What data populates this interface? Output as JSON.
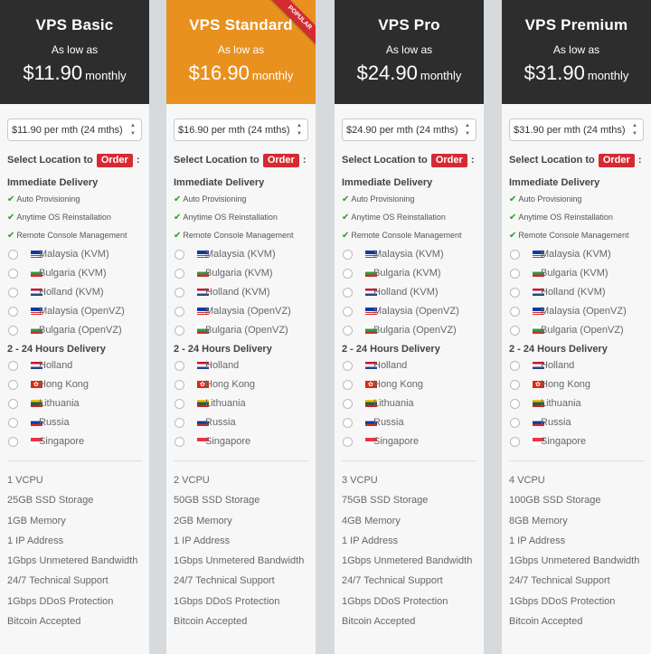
{
  "plans": [
    {
      "name": "VPS Basic",
      "as_low": "As low as",
      "price": "$11.90",
      "period": "monthly",
      "select_value": "$11.90 per mth (24 mths)",
      "specs": [
        "1 VCPU",
        "25GB SSD Storage",
        "1GB Memory",
        "1 IP Address",
        "1Gbps Unmetered Bandwidth",
        "24/7 Technical Support",
        "1Gbps DDoS Protection",
        "Bitcoin Accepted"
      ]
    },
    {
      "name": "VPS Standard",
      "as_low": "As low as",
      "price": "$16.90",
      "period": "monthly",
      "badge": "POPULAR",
      "select_value": "$16.90 per mth (24 mths)",
      "specs": [
        "2 VCPU",
        "50GB SSD Storage",
        "2GB Memory",
        "1 IP Address",
        "1Gbps Unmetered Bandwidth",
        "24/7 Technical Support",
        "1Gbps DDoS Protection",
        "Bitcoin Accepted"
      ]
    },
    {
      "name": "VPS Pro",
      "as_low": "As low as",
      "price": "$24.90",
      "period": "monthly",
      "select_value": "$24.90 per mth (24 mths)",
      "specs": [
        "3 VCPU",
        "75GB SSD Storage",
        "4GB Memory",
        "1 IP Address",
        "1Gbps Unmetered Bandwidth",
        "24/7 Technical Support",
        "1Gbps DDoS Protection",
        "Bitcoin Accepted"
      ]
    },
    {
      "name": "VPS Premium",
      "as_low": "As low as",
      "price": "$31.90",
      "period": "monthly",
      "select_value": "$31.90 per mth (24 mths)",
      "specs": [
        "4 VCPU",
        "100GB SSD Storage",
        "8GB Memory",
        "1 IP Address",
        "1Gbps Unmetered Bandwidth",
        "24/7 Technical Support",
        "1Gbps DDoS Protection",
        "Bitcoin Accepted"
      ]
    }
  ],
  "common": {
    "select_location": "Select Location to",
    "order_label": "Order",
    "colon": ":",
    "immediate_title": "Immediate Delivery",
    "features": [
      "Auto Provisioning",
      "Anytime OS Reinstallation",
      "Remote Console Management"
    ],
    "immediate_locations": [
      {
        "name": "Malaysia (KVM)",
        "flag": "my"
      },
      {
        "name": "Bulgaria (KVM)",
        "flag": "bg"
      },
      {
        "name": "Holland (KVM)",
        "flag": "nl"
      },
      {
        "name": "Malaysia (OpenVZ)",
        "flag": "my"
      },
      {
        "name": "Bulgaria (OpenVZ)",
        "flag": "bg"
      }
    ],
    "delayed_title": "2 - 24 Hours Delivery",
    "delayed_locations": [
      {
        "name": "Holland",
        "flag": "nl"
      },
      {
        "name": "Hong Kong",
        "flag": "hk"
      },
      {
        "name": "Lithuania",
        "flag": "lt"
      },
      {
        "name": "Russia",
        "flag": "ru"
      },
      {
        "name": "Singapore",
        "flag": "sg"
      }
    ]
  },
  "colors": {
    "header_dark": "#2d2d2d",
    "featured": "#e8911f",
    "order_red": "#d62a33",
    "check_green": "#2a9a2a"
  }
}
